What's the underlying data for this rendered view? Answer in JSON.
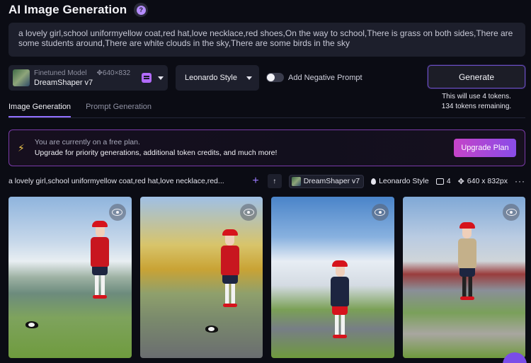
{
  "header": {
    "title": "AI Image Generation",
    "help_icon": "?"
  },
  "prompt": {
    "text": "a lovely girl,school uniformyellow coat,red hat,love necklace,red shoes,On the way to school,There is grass on both sides,There are some students around,There are white clouds in the sky,There are some birds in the sky"
  },
  "model": {
    "label": "Finetuned Model",
    "size": "640×832",
    "name": "DreamShaper v7"
  },
  "style": {
    "selected": "Leonardo Style"
  },
  "negative_prompt": {
    "label": "Add Negative Prompt",
    "enabled": false
  },
  "generate": {
    "label": "Generate",
    "token_use": "This will use 4 tokens.",
    "tokens_remaining": "134 tokens remaining."
  },
  "tabs": [
    {
      "label": "Image Generation",
      "active": true
    },
    {
      "label": "Prompt Generation",
      "active": false
    }
  ],
  "banner": {
    "line1": "You are currently on a free plan.",
    "line2": "Upgrade for priority generations, additional token credits, and much more!",
    "button": "Upgrade Plan"
  },
  "generation": {
    "prompt_preview": "a lovely girl,school uniformyellow coat,red hat,love necklace,red...",
    "model": "DreamShaper v7",
    "style": "Leonardo Style",
    "count": "4",
    "size": "640 x 832px",
    "more": "···"
  },
  "colors": {
    "accent": "#9270ff",
    "banner_border": "#7a3aa8",
    "upgrade_start": "#c544c8",
    "upgrade_end": "#8a4ce8"
  }
}
